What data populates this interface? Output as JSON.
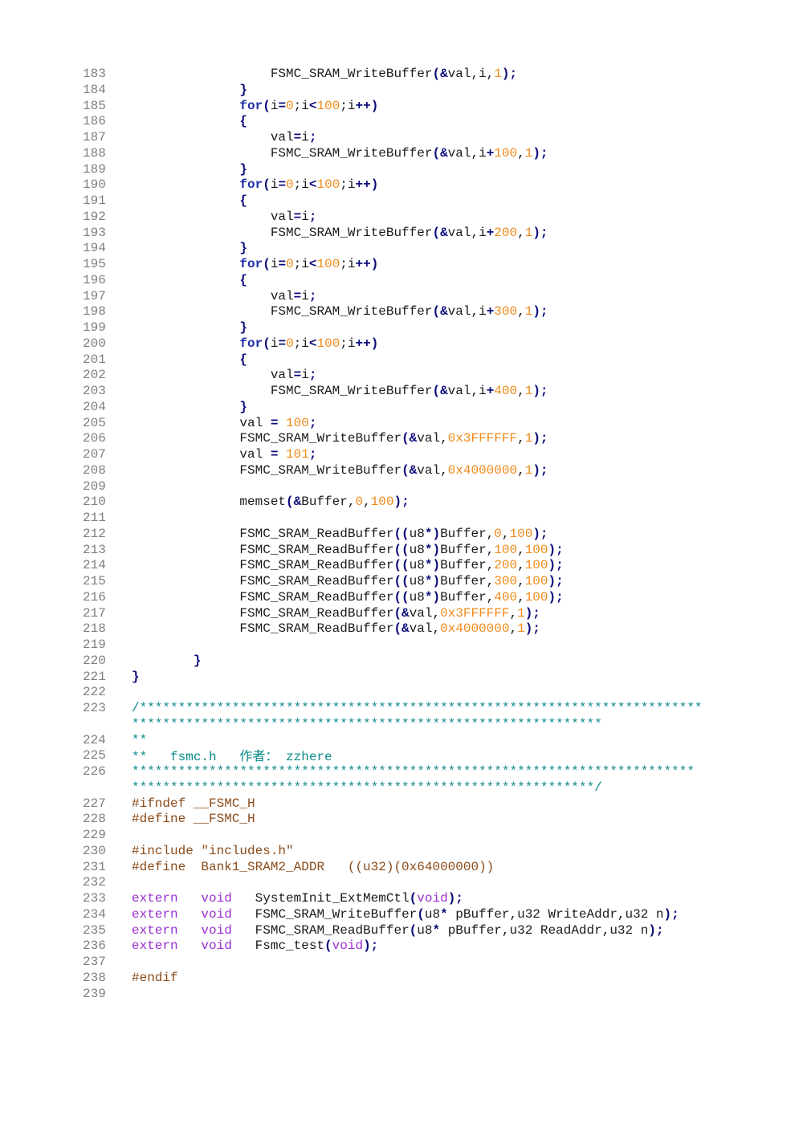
{
  "code_listing": {
    "lines": [
      {
        "n": "183",
        "seg": [
          [
            "t",
            "                  FSMC_SRAM_WriteBuffer"
          ],
          [
            "p",
            "(&"
          ],
          [
            "t",
            "val,i,"
          ],
          [
            "n",
            "1"
          ],
          [
            "p",
            ");"
          ]
        ]
      },
      {
        "n": "184",
        "seg": [
          [
            "t",
            "              "
          ],
          [
            "p",
            "}"
          ]
        ]
      },
      {
        "n": "185",
        "seg": [
          [
            "t",
            "              "
          ],
          [
            "k",
            "for"
          ],
          [
            "p",
            "("
          ],
          [
            "t",
            "i"
          ],
          [
            "p",
            "="
          ],
          [
            "n",
            "0"
          ],
          [
            "t",
            ";i"
          ],
          [
            "p",
            "<"
          ],
          [
            "n",
            "100"
          ],
          [
            "t",
            ";i"
          ],
          [
            "p",
            "++)"
          ]
        ]
      },
      {
        "n": "186",
        "seg": [
          [
            "t",
            "              "
          ],
          [
            "p",
            "{"
          ]
        ]
      },
      {
        "n": "187",
        "seg": [
          [
            "t",
            "                  val"
          ],
          [
            "p",
            "="
          ],
          [
            "t",
            "i"
          ],
          [
            "p",
            ";"
          ]
        ]
      },
      {
        "n": "188",
        "seg": [
          [
            "t",
            "                  FSMC_SRAM_WriteBuffer"
          ],
          [
            "p",
            "(&"
          ],
          [
            "t",
            "val,i"
          ],
          [
            "p",
            "+"
          ],
          [
            "n",
            "100"
          ],
          [
            "t",
            ","
          ],
          [
            "n",
            "1"
          ],
          [
            "p",
            ");"
          ]
        ]
      },
      {
        "n": "189",
        "seg": [
          [
            "t",
            "              "
          ],
          [
            "p",
            "}"
          ]
        ]
      },
      {
        "n": "190",
        "seg": [
          [
            "t",
            "              "
          ],
          [
            "k",
            "for"
          ],
          [
            "p",
            "("
          ],
          [
            "t",
            "i"
          ],
          [
            "p",
            "="
          ],
          [
            "n",
            "0"
          ],
          [
            "t",
            ";i"
          ],
          [
            "p",
            "<"
          ],
          [
            "n",
            "100"
          ],
          [
            "t",
            ";i"
          ],
          [
            "p",
            "++)"
          ]
        ]
      },
      {
        "n": "191",
        "seg": [
          [
            "t",
            "              "
          ],
          [
            "p",
            "{"
          ]
        ]
      },
      {
        "n": "192",
        "seg": [
          [
            "t",
            "                  val"
          ],
          [
            "p",
            "="
          ],
          [
            "t",
            "i"
          ],
          [
            "p",
            ";"
          ]
        ]
      },
      {
        "n": "193",
        "seg": [
          [
            "t",
            "                  FSMC_SRAM_WriteBuffer"
          ],
          [
            "p",
            "(&"
          ],
          [
            "t",
            "val,i"
          ],
          [
            "p",
            "+"
          ],
          [
            "n",
            "200"
          ],
          [
            "t",
            ","
          ],
          [
            "n",
            "1"
          ],
          [
            "p",
            ");"
          ]
        ]
      },
      {
        "n": "194",
        "seg": [
          [
            "t",
            "              "
          ],
          [
            "p",
            "}"
          ]
        ]
      },
      {
        "n": "195",
        "seg": [
          [
            "t",
            "              "
          ],
          [
            "k",
            "for"
          ],
          [
            "p",
            "("
          ],
          [
            "t",
            "i"
          ],
          [
            "p",
            "="
          ],
          [
            "n",
            "0"
          ],
          [
            "t",
            ";i"
          ],
          [
            "p",
            "<"
          ],
          [
            "n",
            "100"
          ],
          [
            "t",
            ";i"
          ],
          [
            "p",
            "++)"
          ]
        ]
      },
      {
        "n": "196",
        "seg": [
          [
            "t",
            "              "
          ],
          [
            "p",
            "{"
          ]
        ]
      },
      {
        "n": "197",
        "seg": [
          [
            "t",
            "                  val"
          ],
          [
            "p",
            "="
          ],
          [
            "t",
            "i"
          ],
          [
            "p",
            ";"
          ]
        ]
      },
      {
        "n": "198",
        "seg": [
          [
            "t",
            "                  FSMC_SRAM_WriteBuffer"
          ],
          [
            "p",
            "(&"
          ],
          [
            "t",
            "val,i"
          ],
          [
            "p",
            "+"
          ],
          [
            "n",
            "300"
          ],
          [
            "t",
            ","
          ],
          [
            "n",
            "1"
          ],
          [
            "p",
            ");"
          ]
        ]
      },
      {
        "n": "199",
        "seg": [
          [
            "t",
            "              "
          ],
          [
            "p",
            "}"
          ]
        ]
      },
      {
        "n": "200",
        "seg": [
          [
            "t",
            "              "
          ],
          [
            "k",
            "for"
          ],
          [
            "p",
            "("
          ],
          [
            "t",
            "i"
          ],
          [
            "p",
            "="
          ],
          [
            "n",
            "0"
          ],
          [
            "t",
            ";i"
          ],
          [
            "p",
            "<"
          ],
          [
            "n",
            "100"
          ],
          [
            "t",
            ";i"
          ],
          [
            "p",
            "++)"
          ]
        ]
      },
      {
        "n": "201",
        "seg": [
          [
            "t",
            "              "
          ],
          [
            "p",
            "{"
          ]
        ]
      },
      {
        "n": "202",
        "seg": [
          [
            "t",
            "                  val"
          ],
          [
            "p",
            "="
          ],
          [
            "t",
            "i"
          ],
          [
            "p",
            ";"
          ]
        ]
      },
      {
        "n": "203",
        "seg": [
          [
            "t",
            "                  FSMC_SRAM_WriteBuffer"
          ],
          [
            "p",
            "(&"
          ],
          [
            "t",
            "val,i"
          ],
          [
            "p",
            "+"
          ],
          [
            "n",
            "400"
          ],
          [
            "t",
            ","
          ],
          [
            "n",
            "1"
          ],
          [
            "p",
            ");"
          ]
        ]
      },
      {
        "n": "204",
        "seg": [
          [
            "t",
            "              "
          ],
          [
            "p",
            "}"
          ]
        ]
      },
      {
        "n": "205",
        "seg": [
          [
            "t",
            "              val "
          ],
          [
            "p",
            "="
          ],
          [
            "t",
            " "
          ],
          [
            "n",
            "100"
          ],
          [
            "p",
            ";"
          ]
        ]
      },
      {
        "n": "206",
        "seg": [
          [
            "t",
            "              FSMC_SRAM_WriteBuffer"
          ],
          [
            "p",
            "(&"
          ],
          [
            "t",
            "val,"
          ],
          [
            "n",
            "0x3FFFFFF"
          ],
          [
            "t",
            ","
          ],
          [
            "n",
            "1"
          ],
          [
            "p",
            ");"
          ]
        ]
      },
      {
        "n": "207",
        "seg": [
          [
            "t",
            "              val "
          ],
          [
            "p",
            "="
          ],
          [
            "t",
            " "
          ],
          [
            "n",
            "101"
          ],
          [
            "p",
            ";"
          ]
        ]
      },
      {
        "n": "208",
        "seg": [
          [
            "t",
            "              FSMC_SRAM_WriteBuffer"
          ],
          [
            "p",
            "(&"
          ],
          [
            "t",
            "val,"
          ],
          [
            "n",
            "0x4000000"
          ],
          [
            "t",
            ","
          ],
          [
            "n",
            "1"
          ],
          [
            "p",
            ");"
          ]
        ]
      },
      {
        "n": "209",
        "seg": []
      },
      {
        "n": "210",
        "seg": [
          [
            "t",
            "              memset"
          ],
          [
            "p",
            "(&"
          ],
          [
            "t",
            "Buffer,"
          ],
          [
            "n",
            "0"
          ],
          [
            "t",
            ","
          ],
          [
            "n",
            "100"
          ],
          [
            "p",
            ");"
          ]
        ]
      },
      {
        "n": "211",
        "seg": []
      },
      {
        "n": "212",
        "seg": [
          [
            "t",
            "              FSMC_SRAM_ReadBuffer"
          ],
          [
            "p",
            "(("
          ],
          [
            "t",
            "u8"
          ],
          [
            "p",
            "*)"
          ],
          [
            "t",
            "Buffer,"
          ],
          [
            "n",
            "0"
          ],
          [
            "t",
            ","
          ],
          [
            "n",
            "100"
          ],
          [
            "p",
            ");"
          ]
        ]
      },
      {
        "n": "213",
        "seg": [
          [
            "t",
            "              FSMC_SRAM_ReadBuffer"
          ],
          [
            "p",
            "(("
          ],
          [
            "t",
            "u8"
          ],
          [
            "p",
            "*)"
          ],
          [
            "t",
            "Buffer,"
          ],
          [
            "n",
            "100"
          ],
          [
            "t",
            ","
          ],
          [
            "n",
            "100"
          ],
          [
            "p",
            ");"
          ]
        ]
      },
      {
        "n": "214",
        "seg": [
          [
            "t",
            "              FSMC_SRAM_ReadBuffer"
          ],
          [
            "p",
            "(("
          ],
          [
            "t",
            "u8"
          ],
          [
            "p",
            "*)"
          ],
          [
            "t",
            "Buffer,"
          ],
          [
            "n",
            "200"
          ],
          [
            "t",
            ","
          ],
          [
            "n",
            "100"
          ],
          [
            "p",
            ");"
          ]
        ]
      },
      {
        "n": "215",
        "seg": [
          [
            "t",
            "              FSMC_SRAM_ReadBuffer"
          ],
          [
            "p",
            "(("
          ],
          [
            "t",
            "u8"
          ],
          [
            "p",
            "*)"
          ],
          [
            "t",
            "Buffer,"
          ],
          [
            "n",
            "300"
          ],
          [
            "t",
            ","
          ],
          [
            "n",
            "100"
          ],
          [
            "p",
            ");"
          ]
        ]
      },
      {
        "n": "216",
        "seg": [
          [
            "t",
            "              FSMC_SRAM_ReadBuffer"
          ],
          [
            "p",
            "(("
          ],
          [
            "t",
            "u8"
          ],
          [
            "p",
            "*)"
          ],
          [
            "t",
            "Buffer,"
          ],
          [
            "n",
            "400"
          ],
          [
            "t",
            ","
          ],
          [
            "n",
            "100"
          ],
          [
            "p",
            ");"
          ]
        ]
      },
      {
        "n": "217",
        "seg": [
          [
            "t",
            "              FSMC_SRAM_ReadBuffer"
          ],
          [
            "p",
            "(&"
          ],
          [
            "t",
            "val,"
          ],
          [
            "n",
            "0x3FFFFFF"
          ],
          [
            "t",
            ","
          ],
          [
            "n",
            "1"
          ],
          [
            "p",
            ");"
          ]
        ]
      },
      {
        "n": "218",
        "seg": [
          [
            "t",
            "              FSMC_SRAM_ReadBuffer"
          ],
          [
            "p",
            "(&"
          ],
          [
            "t",
            "val,"
          ],
          [
            "n",
            "0x4000000"
          ],
          [
            "t",
            ","
          ],
          [
            "n",
            "1"
          ],
          [
            "p",
            ");"
          ]
        ]
      },
      {
        "n": "219",
        "seg": []
      },
      {
        "n": "220",
        "seg": [
          [
            "t",
            "        "
          ],
          [
            "p",
            "}"
          ]
        ]
      },
      {
        "n": "221",
        "seg": [
          [
            "p",
            "}"
          ]
        ]
      },
      {
        "n": "222",
        "seg": []
      },
      {
        "n": "223",
        "seg": [
          [
            "c",
            "/*************************************************************************"
          ]
        ]
      },
      {
        "n": "",
        "seg": [
          [
            "c",
            "*************************************************************"
          ]
        ]
      },
      {
        "n": "224",
        "seg": [
          [
            "c",
            "**"
          ]
        ]
      },
      {
        "n": "225",
        "seg": [
          [
            "c",
            "**   fsmc.h   "
          ],
          [
            "cj",
            "作者："
          ],
          [
            "c",
            " zzhere"
          ]
        ]
      },
      {
        "n": "226",
        "seg": [
          [
            "c",
            "*************************************************************************"
          ]
        ]
      },
      {
        "n": "",
        "seg": [
          [
            "c",
            "************************************************************/"
          ]
        ]
      },
      {
        "n": "227",
        "seg": [
          [
            "pp",
            "#ifndef __FSMC_H"
          ]
        ]
      },
      {
        "n": "228",
        "seg": [
          [
            "pp",
            "#define __FSMC_H"
          ]
        ]
      },
      {
        "n": "229",
        "seg": []
      },
      {
        "n": "230",
        "seg": [
          [
            "pp",
            "#include \"includes.h\""
          ]
        ]
      },
      {
        "n": "231",
        "seg": [
          [
            "pp",
            "#define  Bank1_SRAM2_ADDR   ((u32)(0x64000000))"
          ]
        ]
      },
      {
        "n": "232",
        "seg": []
      },
      {
        "n": "233",
        "seg": [
          [
            "kw",
            "extern"
          ],
          [
            "t",
            "   "
          ],
          [
            "kw",
            "void"
          ],
          [
            "t",
            "   SystemInit_ExtMemCtl"
          ],
          [
            "p",
            "("
          ],
          [
            "kw",
            "void"
          ],
          [
            "p",
            ");"
          ]
        ]
      },
      {
        "n": "234",
        "seg": [
          [
            "kw",
            "extern"
          ],
          [
            "t",
            "   "
          ],
          [
            "kw",
            "void"
          ],
          [
            "t",
            "   FSMC_SRAM_WriteBuffer"
          ],
          [
            "p",
            "("
          ],
          [
            "t",
            "u8"
          ],
          [
            "p",
            "*"
          ],
          [
            "t",
            " pBuffer,u32 WriteAddr,u32 n"
          ],
          [
            "p",
            ");"
          ]
        ]
      },
      {
        "n": "235",
        "seg": [
          [
            "kw",
            "extern"
          ],
          [
            "t",
            "   "
          ],
          [
            "kw",
            "void"
          ],
          [
            "t",
            "   FSMC_SRAM_ReadBuffer"
          ],
          [
            "p",
            "("
          ],
          [
            "t",
            "u8"
          ],
          [
            "p",
            "*"
          ],
          [
            "t",
            " pBuffer,u32 ReadAddr,u32 n"
          ],
          [
            "p",
            ");"
          ]
        ]
      },
      {
        "n": "236",
        "seg": [
          [
            "kw",
            "extern"
          ],
          [
            "t",
            "   "
          ],
          [
            "kw",
            "void"
          ],
          [
            "t",
            "   Fsmc_test"
          ],
          [
            "p",
            "("
          ],
          [
            "kw",
            "void"
          ],
          [
            "p",
            ");"
          ]
        ]
      },
      {
        "n": "237",
        "seg": []
      },
      {
        "n": "238",
        "seg": [
          [
            "pp",
            "#endif"
          ]
        ]
      },
      {
        "n": "239",
        "seg": []
      }
    ]
  }
}
